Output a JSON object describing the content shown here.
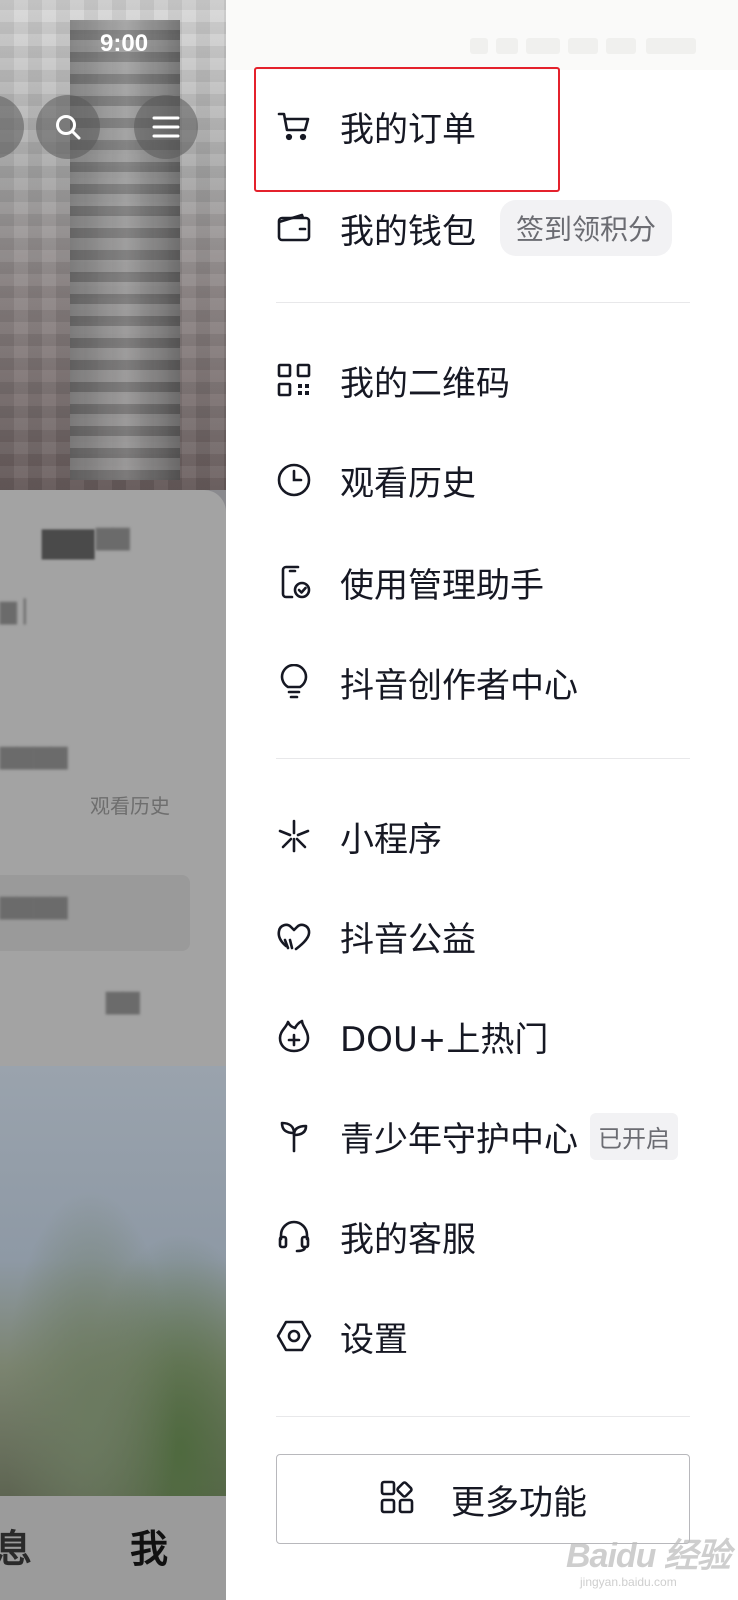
{
  "status_bar": {
    "time": "9:00"
  },
  "background": {
    "history_text": "观看历史",
    "tabs": {
      "message": "息",
      "me": "我"
    }
  },
  "drawer": {
    "group1": [
      {
        "label": "我的订单",
        "icon": "cart-icon"
      },
      {
        "label": "我的钱包",
        "icon": "wallet-icon",
        "badge": "签到领积分"
      }
    ],
    "group2": [
      {
        "label": "我的二维码",
        "icon": "qrcode-icon"
      },
      {
        "label": "观看历史",
        "icon": "clock-icon"
      },
      {
        "label": "使用管理助手",
        "icon": "phone-check-icon"
      },
      {
        "label": "抖音创作者中心",
        "icon": "lightbulb-icon"
      }
    ],
    "group3": [
      {
        "label": "小程序",
        "icon": "asterisk-icon"
      },
      {
        "label": "抖音公益",
        "icon": "heart-icon"
      },
      {
        "label": "DOU+上热门",
        "icon": "flame-plus-icon"
      },
      {
        "label": "青少年守护中心",
        "icon": "sprout-icon",
        "badge": "已开启"
      },
      {
        "label": "我的客服",
        "icon": "headset-icon"
      },
      {
        "label": "设置",
        "icon": "settings-hexagon-icon"
      }
    ],
    "more_button": {
      "label": "更多功能",
      "icon": "apps-icon"
    }
  },
  "highlight_color": "#e4212c",
  "watermark": {
    "main": "Baidu 经验",
    "sub": "jingyan.baidu.com"
  }
}
